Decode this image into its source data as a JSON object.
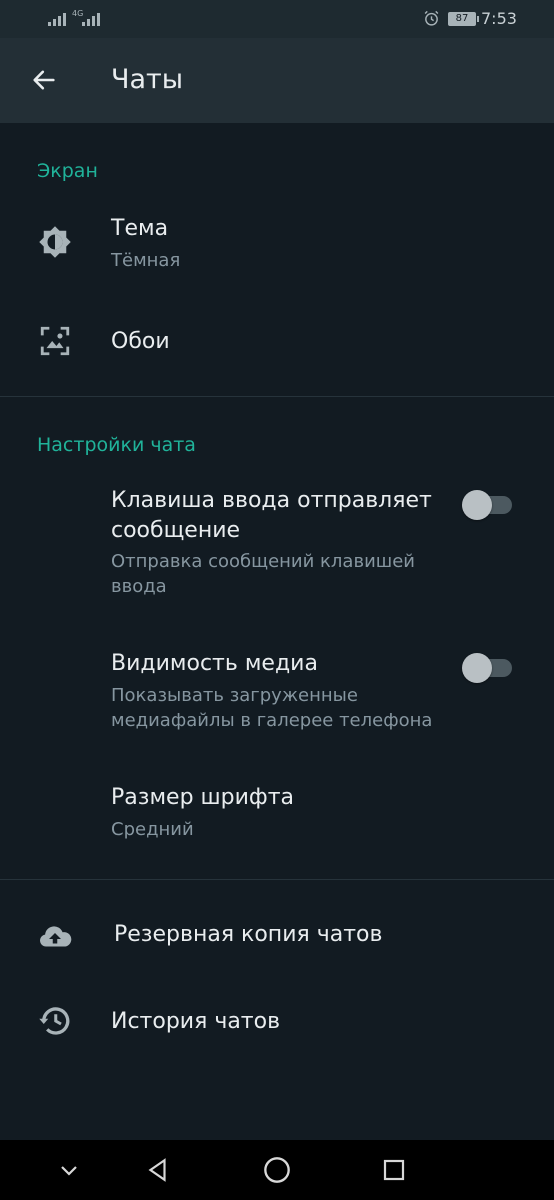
{
  "status_bar": {
    "network_left": "4G",
    "network_right": "4G",
    "battery": "87",
    "time": "7:53",
    "icons": [
      "signal-icon",
      "alarm-icon",
      "battery-icon"
    ]
  },
  "app_bar": {
    "title": "Чаты",
    "back_icon": "arrow-left-icon"
  },
  "sections": {
    "screen": {
      "header": "Экран",
      "items": [
        {
          "title": "Тема",
          "subtitle": "Тёмная",
          "icon": "brightness-icon"
        },
        {
          "title": "Обои",
          "icon": "wallpaper-icon"
        }
      ]
    },
    "chat_settings": {
      "header": "Настройки чата",
      "items": [
        {
          "title_line1": "Клавиша ввода отправляет",
          "title_line2": "сообщение",
          "subtitle_line1": "Отправка сообщений клавишей",
          "subtitle_line2": "ввода",
          "toggle_on": false
        },
        {
          "title": "Видимость медиа",
          "subtitle_line1": "Показывать загруженные",
          "subtitle_line2": "медиафайлы в галерее телефона",
          "toggle_on": false
        },
        {
          "title": "Размер шрифта",
          "subtitle": "Средний"
        }
      ]
    },
    "backup": {
      "items": [
        {
          "title": "Резервная копия чатов",
          "icon": "cloud-upload-icon"
        },
        {
          "title": "История чатов",
          "icon": "history-icon"
        }
      ]
    }
  },
  "nav_bar": {
    "icons": [
      "chevron-down-icon",
      "back-triangle-icon",
      "home-circle-icon",
      "recents-square-icon"
    ]
  },
  "colors": {
    "background": "#121b22",
    "app_bar": "#232f36",
    "accent": "#20b39a",
    "primary_text": "#e9edef",
    "secondary_text": "#8696a0"
  }
}
